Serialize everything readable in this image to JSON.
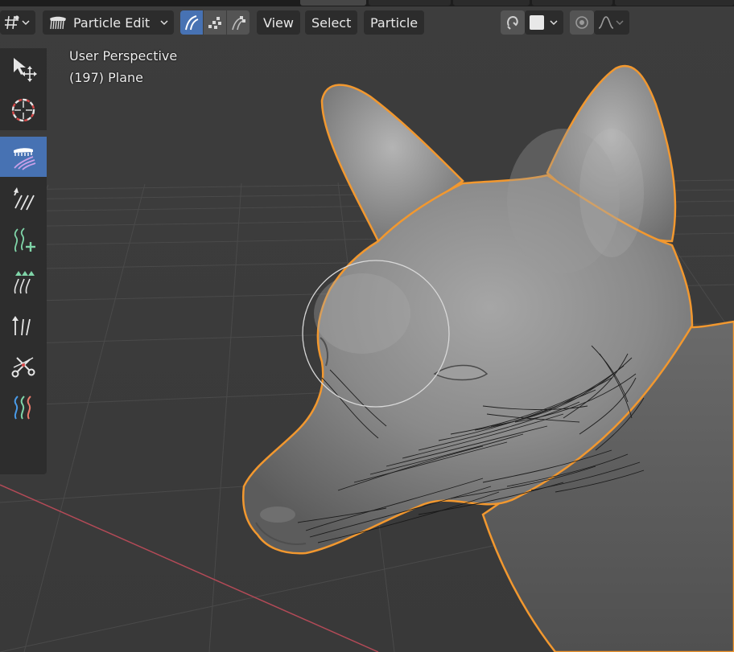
{
  "header": {
    "mode": {
      "label": "Particle Edit",
      "icon": "comb-brush-icon"
    },
    "select_modes": [
      {
        "name": "path-mode-icon",
        "active": true
      },
      {
        "name": "point-mode-icon",
        "active": false
      },
      {
        "name": "tip-mode-icon",
        "active": false
      }
    ],
    "menus": [
      "View",
      "Select",
      "Particle"
    ],
    "editor_type_icon": "viewport-icon",
    "right_controls": {
      "snap_icon": "snap-icon",
      "color_swatch": "#e8e8e8",
      "proportional_icon": "proportional-icon",
      "falloff_icon": "falloff-curve-icon"
    }
  },
  "toolbar": {
    "tools": [
      {
        "name": "select-move-tool",
        "icon": "cursor-move-icon",
        "active": false
      },
      {
        "name": "cursor-tool",
        "icon": "3d-cursor-icon",
        "active": false
      },
      {
        "name": "comb-tool",
        "icon": "comb-icon",
        "active": true
      },
      {
        "name": "smooth-tool",
        "icon": "smooth-strands-icon",
        "active": false
      },
      {
        "name": "add-tool",
        "icon": "add-strands-icon",
        "active": false
      },
      {
        "name": "length-tool",
        "icon": "length-strands-icon",
        "active": false
      },
      {
        "name": "puff-tool",
        "icon": "puff-strands-icon",
        "active": false
      },
      {
        "name": "cut-tool",
        "icon": "cut-scissors-icon",
        "active": false
      },
      {
        "name": "weight-tool",
        "icon": "weight-strands-icon",
        "active": false
      }
    ]
  },
  "overlay": {
    "view_name": "User Perspective",
    "object_info": "(197) Plane"
  },
  "colors": {
    "active": "#4772b3",
    "selection_outline": "#f2982f",
    "axis_x": "#b34a57",
    "background": "#3d3d3d"
  },
  "brush": {
    "shape": "circle"
  }
}
